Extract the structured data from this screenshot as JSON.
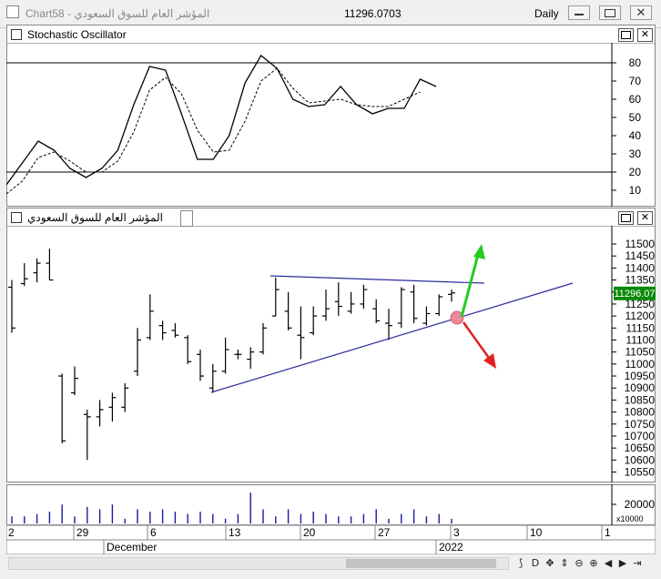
{
  "window": {
    "title": "Chart58 - المؤشر العام للسوق السعودي",
    "last_value": "11296.0703",
    "period": "Daily"
  },
  "stochastic_pane": {
    "title": "Stochastic Oscillator",
    "y_ticks": [
      "80",
      "70",
      "60",
      "50",
      "40",
      "30",
      "20",
      "10"
    ],
    "k_line": [
      13,
      25,
      37,
      32,
      22,
      17,
      22,
      32,
      57,
      78,
      76,
      52,
      27,
      27,
      40,
      69,
      84,
      77,
      60,
      56,
      57,
      67,
      57,
      52,
      55,
      55,
      71,
      67
    ],
    "d_line": [
      8,
      15,
      28,
      31,
      26,
      20,
      20,
      26,
      42,
      65,
      72,
      63,
      43,
      31,
      32,
      48,
      70,
      77,
      66,
      58,
      59,
      60,
      57,
      56,
      56,
      60,
      64
    ],
    "levels": [
      80,
      20
    ]
  },
  "price_pane": {
    "title": "المؤشر العام للسوق السعودي",
    "y_ticks": [
      "11500",
      "11450",
      "11400",
      "11350",
      "11300",
      "11250",
      "11200",
      "11150",
      "11100",
      "11050",
      "11000",
      "10950",
      "10900",
      "10850",
      "10800",
      "10750",
      "10700",
      "10650",
      "10600",
      "10550"
    ],
    "last_price_label": "11296.07",
    "bars": [
      {
        "h": 11350,
        "l": 11130,
        "o": 11320,
        "c": 11150
      },
      {
        "h": 11420,
        "l": 11325,
        "o": 11335,
        "c": 11355
      },
      {
        "h": 11440,
        "l": 11340,
        "o": 11380,
        "c": 11420
      },
      {
        "h": 11480,
        "l": 11350,
        "o": 11420,
        "c": 11350
      },
      {
        "h": 10960,
        "l": 10670,
        "o": 10950,
        "c": 10680
      },
      {
        "h": 10990,
        "l": 10870,
        "o": 10880,
        "c": 10940
      },
      {
        "h": 10810,
        "l": 10600,
        "o": 10790,
        "c": 10780
      },
      {
        "h": 10850,
        "l": 10740,
        "o": 10780,
        "c": 10810
      },
      {
        "h": 10880,
        "l": 10760,
        "o": 10820,
        "c": 10860
      },
      {
        "h": 10920,
        "l": 10800,
        "o": 10820,
        "c": 10900
      },
      {
        "h": 11150,
        "l": 10950,
        "o": 10970,
        "c": 11100
      },
      {
        "h": 11290,
        "l": 11100,
        "o": 11110,
        "c": 11220
      },
      {
        "h": 11180,
        "l": 11100,
        "o": 11160,
        "c": 11130
      },
      {
        "h": 11170,
        "l": 11110,
        "o": 11140,
        "c": 11120
      },
      {
        "h": 11120,
        "l": 11000,
        "o": 11110,
        "c": 11010
      },
      {
        "h": 11060,
        "l": 10930,
        "o": 11040,
        "c": 10950
      },
      {
        "h": 11000,
        "l": 10880,
        "o": 10900,
        "c": 10970
      },
      {
        "h": 11110,
        "l": 10960,
        "o": 10970,
        "c": 11060
      },
      {
        "h": 11060,
        "l": 11020,
        "o": 11040,
        "c": 11040
      },
      {
        "h": 11070,
        "l": 10980,
        "o": 11020,
        "c": 11050
      },
      {
        "h": 11170,
        "l": 11040,
        "o": 11050,
        "c": 11150
      },
      {
        "h": 11360,
        "l": 11200,
        "o": 11200,
        "c": 11310
      },
      {
        "h": 11300,
        "l": 11140,
        "o": 11220,
        "c": 11150
      },
      {
        "h": 11240,
        "l": 11020,
        "o": 11120,
        "c": 11110
      },
      {
        "h": 11240,
        "l": 11120,
        "o": 11130,
        "c": 11200
      },
      {
        "h": 11310,
        "l": 11180,
        "o": 11200,
        "c": 11230
      },
      {
        "h": 11340,
        "l": 11200,
        "o": 11260,
        "c": 11240
      },
      {
        "h": 11300,
        "l": 11210,
        "o": 11220,
        "c": 11250
      },
      {
        "h": 11330,
        "l": 11230,
        "o": 11250,
        "c": 11310
      },
      {
        "h": 11270,
        "l": 11170,
        "o": 11230,
        "c": 11180
      },
      {
        "h": 11230,
        "l": 11100,
        "o": 11170,
        "c": 11160
      },
      {
        "h": 11320,
        "l": 11150,
        "o": 11170,
        "c": 11310
      },
      {
        "h": 11330,
        "l": 11170,
        "o": 11300,
        "c": 11190
      },
      {
        "h": 11240,
        "l": 11160,
        "o": 11170,
        "c": 11210
      },
      {
        "h": 11290,
        "l": 11200,
        "o": 11210,
        "c": 11280
      },
      {
        "h": 11310,
        "l": 11260,
        "o": 11290,
        "c": 11296
      }
    ]
  },
  "volume_pane": {
    "y_ticks": [
      "20000"
    ],
    "multiplier": "x10000",
    "volumes": [
      3,
      3,
      4,
      5,
      8,
      3,
      7,
      6,
      8,
      2,
      6,
      5,
      6,
      5,
      4,
      5,
      4,
      2,
      4,
      13,
      6,
      3,
      6,
      4,
      5,
      4,
      3,
      3,
      4,
      6,
      2,
      4,
      6,
      3,
      4,
      2
    ]
  },
  "time_axis": {
    "ticks": [
      "2",
      "29",
      "6",
      "13",
      "20",
      "27",
      "3",
      "10",
      "1"
    ],
    "months": [
      "December",
      "2022"
    ]
  },
  "toolbar": {
    "icons": [
      "cursor-icon",
      "d-icon",
      "move-icon",
      "scroll-icon",
      "zoom-out-icon",
      "zoom-in-icon",
      "left-icon",
      "right-icon",
      "end-icon"
    ]
  },
  "colors": {
    "trend_line": "#2b2ba0",
    "up_arrow": "#22cc22",
    "down_arrow": "#e02020",
    "marker": "#ee8899",
    "price_badge": "#0a8a0a"
  }
}
